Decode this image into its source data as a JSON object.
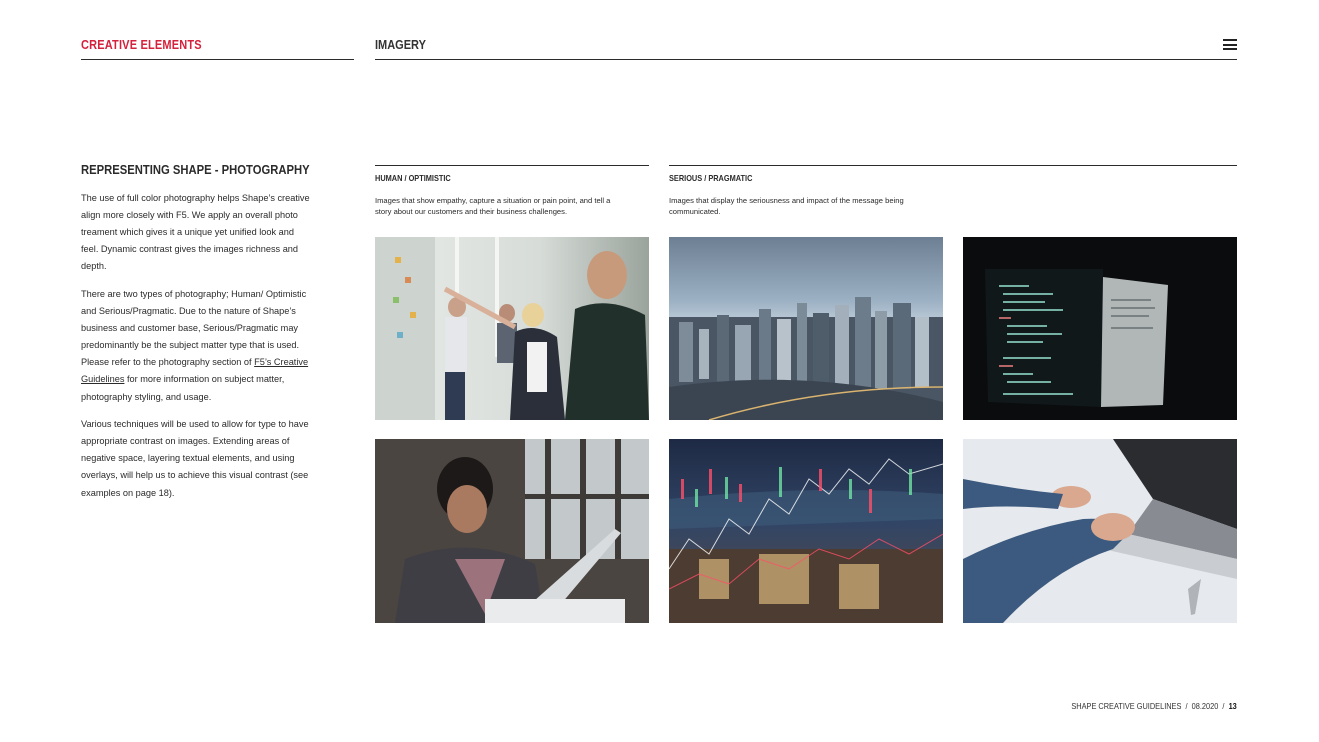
{
  "header": {
    "section": "CREATIVE ELEMENTS",
    "page_topic": "IMAGERY",
    "menu_icon": "hamburger-menu-icon"
  },
  "intro": {
    "title": "REPRESENTING SHAPE - PHOTOGRAPHY",
    "para1": "The use of full color photography helps Shape’s creative align more closely with F5. We apply an overall photo treament which gives it a unique yet unified look and feel. Dynamic contrast gives the images richness and depth.",
    "para2_start": "There are two types of photography; Human/ Optimistic and Serious/Pragmatic. Due to the nature of Shape’s business and customer base, Serious/Pragmatic may predominantly be the subject matter type that is used. Please refer to the photography section of ",
    "para2_link": "F5’s Creative Guidelines",
    "para2_end": " for more information on subject matter, photography styling, and usage.",
    "para3": "Various techniques will be used to allow for type to have appropriate contrast on images. Extending areas of negative space, layering textual elements, and using overlays, will help us to achieve this visual contrast (see examples on page 18)."
  },
  "categories": {
    "human": {
      "label": "HUMAN / OPTIMISTIC",
      "desc": "Images that show empathy, capture a situation or pain point, and tell a story about our customers and their business challenges."
    },
    "serious": {
      "label": "SERIOUS / PRAGMATIC",
      "desc": "Images that display the seriousness and impact of the message being communicated."
    }
  },
  "footer": {
    "doc": "SHAPE CREATIVE GUIDELINES",
    "sep1": "/",
    "date": "08.2020",
    "sep2": "/",
    "page": "13"
  }
}
